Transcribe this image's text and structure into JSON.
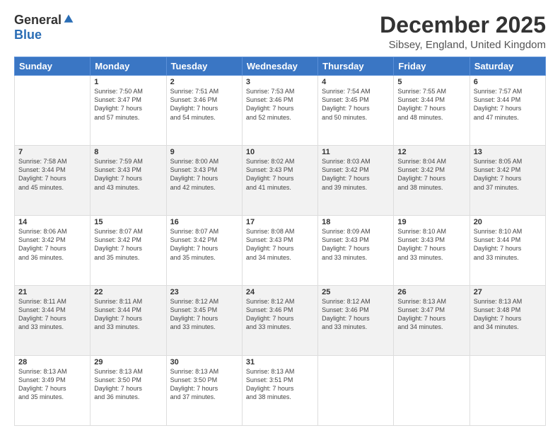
{
  "logo": {
    "general": "General",
    "blue": "Blue"
  },
  "header": {
    "title": "December 2025",
    "subtitle": "Sibsey, England, United Kingdom"
  },
  "days_of_week": [
    "Sunday",
    "Monday",
    "Tuesday",
    "Wednesday",
    "Thursday",
    "Friday",
    "Saturday"
  ],
  "weeks": [
    [
      {
        "day": "",
        "info": ""
      },
      {
        "day": "1",
        "info": "Sunrise: 7:50 AM\nSunset: 3:47 PM\nDaylight: 7 hours\nand 57 minutes."
      },
      {
        "day": "2",
        "info": "Sunrise: 7:51 AM\nSunset: 3:46 PM\nDaylight: 7 hours\nand 54 minutes."
      },
      {
        "day": "3",
        "info": "Sunrise: 7:53 AM\nSunset: 3:46 PM\nDaylight: 7 hours\nand 52 minutes."
      },
      {
        "day": "4",
        "info": "Sunrise: 7:54 AM\nSunset: 3:45 PM\nDaylight: 7 hours\nand 50 minutes."
      },
      {
        "day": "5",
        "info": "Sunrise: 7:55 AM\nSunset: 3:44 PM\nDaylight: 7 hours\nand 48 minutes."
      },
      {
        "day": "6",
        "info": "Sunrise: 7:57 AM\nSunset: 3:44 PM\nDaylight: 7 hours\nand 47 minutes."
      }
    ],
    [
      {
        "day": "7",
        "info": "Sunrise: 7:58 AM\nSunset: 3:44 PM\nDaylight: 7 hours\nand 45 minutes."
      },
      {
        "day": "8",
        "info": "Sunrise: 7:59 AM\nSunset: 3:43 PM\nDaylight: 7 hours\nand 43 minutes."
      },
      {
        "day": "9",
        "info": "Sunrise: 8:00 AM\nSunset: 3:43 PM\nDaylight: 7 hours\nand 42 minutes."
      },
      {
        "day": "10",
        "info": "Sunrise: 8:02 AM\nSunset: 3:43 PM\nDaylight: 7 hours\nand 41 minutes."
      },
      {
        "day": "11",
        "info": "Sunrise: 8:03 AM\nSunset: 3:42 PM\nDaylight: 7 hours\nand 39 minutes."
      },
      {
        "day": "12",
        "info": "Sunrise: 8:04 AM\nSunset: 3:42 PM\nDaylight: 7 hours\nand 38 minutes."
      },
      {
        "day": "13",
        "info": "Sunrise: 8:05 AM\nSunset: 3:42 PM\nDaylight: 7 hours\nand 37 minutes."
      }
    ],
    [
      {
        "day": "14",
        "info": "Sunrise: 8:06 AM\nSunset: 3:42 PM\nDaylight: 7 hours\nand 36 minutes."
      },
      {
        "day": "15",
        "info": "Sunrise: 8:07 AM\nSunset: 3:42 PM\nDaylight: 7 hours\nand 35 minutes."
      },
      {
        "day": "16",
        "info": "Sunrise: 8:07 AM\nSunset: 3:42 PM\nDaylight: 7 hours\nand 35 minutes."
      },
      {
        "day": "17",
        "info": "Sunrise: 8:08 AM\nSunset: 3:43 PM\nDaylight: 7 hours\nand 34 minutes."
      },
      {
        "day": "18",
        "info": "Sunrise: 8:09 AM\nSunset: 3:43 PM\nDaylight: 7 hours\nand 33 minutes."
      },
      {
        "day": "19",
        "info": "Sunrise: 8:10 AM\nSunset: 3:43 PM\nDaylight: 7 hours\nand 33 minutes."
      },
      {
        "day": "20",
        "info": "Sunrise: 8:10 AM\nSunset: 3:44 PM\nDaylight: 7 hours\nand 33 minutes."
      }
    ],
    [
      {
        "day": "21",
        "info": "Sunrise: 8:11 AM\nSunset: 3:44 PM\nDaylight: 7 hours\nand 33 minutes."
      },
      {
        "day": "22",
        "info": "Sunrise: 8:11 AM\nSunset: 3:44 PM\nDaylight: 7 hours\nand 33 minutes."
      },
      {
        "day": "23",
        "info": "Sunrise: 8:12 AM\nSunset: 3:45 PM\nDaylight: 7 hours\nand 33 minutes."
      },
      {
        "day": "24",
        "info": "Sunrise: 8:12 AM\nSunset: 3:46 PM\nDaylight: 7 hours\nand 33 minutes."
      },
      {
        "day": "25",
        "info": "Sunrise: 8:12 AM\nSunset: 3:46 PM\nDaylight: 7 hours\nand 33 minutes."
      },
      {
        "day": "26",
        "info": "Sunrise: 8:13 AM\nSunset: 3:47 PM\nDaylight: 7 hours\nand 34 minutes."
      },
      {
        "day": "27",
        "info": "Sunrise: 8:13 AM\nSunset: 3:48 PM\nDaylight: 7 hours\nand 34 minutes."
      }
    ],
    [
      {
        "day": "28",
        "info": "Sunrise: 8:13 AM\nSunset: 3:49 PM\nDaylight: 7 hours\nand 35 minutes."
      },
      {
        "day": "29",
        "info": "Sunrise: 8:13 AM\nSunset: 3:50 PM\nDaylight: 7 hours\nand 36 minutes."
      },
      {
        "day": "30",
        "info": "Sunrise: 8:13 AM\nSunset: 3:50 PM\nDaylight: 7 hours\nand 37 minutes."
      },
      {
        "day": "31",
        "info": "Sunrise: 8:13 AM\nSunset: 3:51 PM\nDaylight: 7 hours\nand 38 minutes."
      },
      {
        "day": "",
        "info": ""
      },
      {
        "day": "",
        "info": ""
      },
      {
        "day": "",
        "info": ""
      }
    ]
  ]
}
